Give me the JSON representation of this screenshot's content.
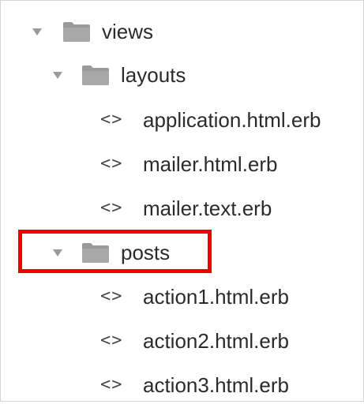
{
  "tree": {
    "views": {
      "label": "views",
      "icon": "folder-icon",
      "expanded": true
    },
    "layouts": {
      "label": "layouts",
      "icon": "folder-icon",
      "expanded": true
    },
    "layout_files": [
      {
        "label": "application.html.erb",
        "icon": "code-file-icon"
      },
      {
        "label": "mailer.html.erb",
        "icon": "code-file-icon"
      },
      {
        "label": "mailer.text.erb",
        "icon": "code-file-icon"
      }
    ],
    "posts": {
      "label": "posts",
      "icon": "folder-icon",
      "expanded": true,
      "highlighted": true
    },
    "post_files": [
      {
        "label": "action1.html.erb",
        "icon": "code-file-icon"
      },
      {
        "label": "action2.html.erb",
        "icon": "code-file-icon"
      },
      {
        "label": "action3.html.erb",
        "icon": "code-file-icon"
      }
    ],
    "file_icon_glyph": "<>"
  },
  "colors": {
    "highlight_border": "#ee0000",
    "folder": "#9a9a9a",
    "text": "#2b2b2b"
  }
}
